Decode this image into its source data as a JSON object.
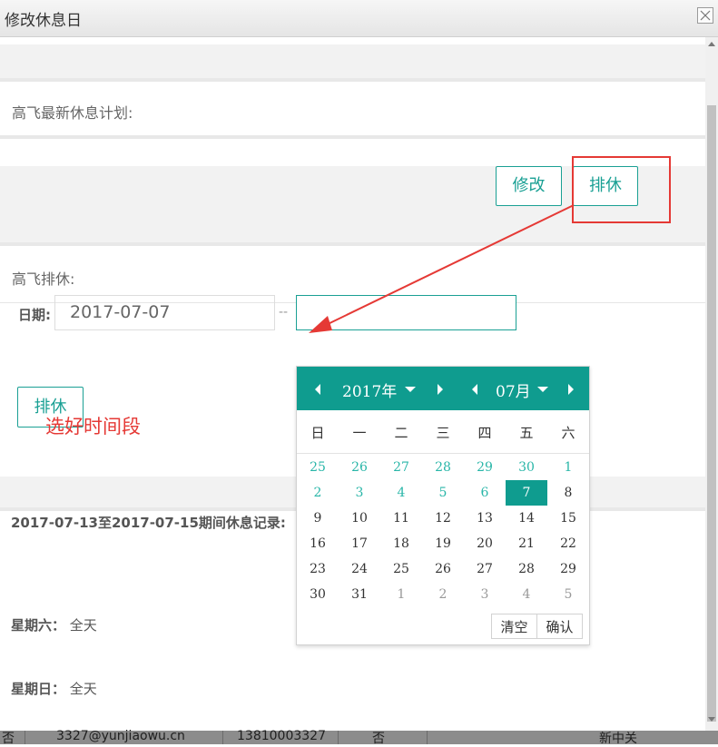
{
  "window": {
    "title": "修改休息日"
  },
  "plan_section": {
    "label": "高飞最新休息计划:"
  },
  "toolbar": {
    "modify_label": "修改",
    "schedule_label": "排休"
  },
  "schedule_section": {
    "label": "高飞排休:",
    "date_label": "日期:",
    "start_date": "2017-07-07",
    "separator": "--",
    "end_date": "",
    "submit_label": "排休"
  },
  "annotation": {
    "text": "选好时间段",
    "color": "#e53935"
  },
  "records": {
    "title": "2017-07-13至2017-07-15期间休息记录:",
    "rows": [
      {
        "day": "星期六：",
        "value": "全天"
      },
      {
        "day": "星期日：",
        "value": "全天"
      }
    ]
  },
  "datepicker": {
    "year_label": "2017年",
    "month_label": "07月",
    "weekdays": [
      "日",
      "一",
      "二",
      "三",
      "四",
      "五",
      "六"
    ],
    "weeks": [
      [
        "25",
        "26",
        "27",
        "28",
        "29",
        "30",
        "1"
      ],
      [
        "2",
        "3",
        "4",
        "5",
        "6",
        "7",
        "8"
      ],
      [
        "9",
        "10",
        "11",
        "12",
        "13",
        "14",
        "15"
      ],
      [
        "16",
        "17",
        "18",
        "19",
        "20",
        "21",
        "22"
      ],
      [
        "23",
        "24",
        "25",
        "26",
        "27",
        "28",
        "29"
      ],
      [
        "30",
        "31",
        "1",
        "2",
        "3",
        "4",
        "5"
      ]
    ],
    "selected_day": "7",
    "clear_label": "清空",
    "confirm_label": "确认",
    "accent_color": "#0f9c8f"
  },
  "background_table_row": {
    "cells": [
      "否",
      "3327@yunjiaowu.cn",
      "13810003327",
      "否",
      "新中关"
    ]
  },
  "icons": {
    "close": "close-icon",
    "prev_year": "caret-left-icon",
    "next_year": "caret-right-icon",
    "year_dropdown": "caret-down-icon",
    "prev_month": "caret-left-icon",
    "next_month": "caret-right-icon",
    "month_dropdown": "caret-down-icon"
  },
  "colors": {
    "brand": "#1aa094",
    "highlight": "#e53935"
  }
}
